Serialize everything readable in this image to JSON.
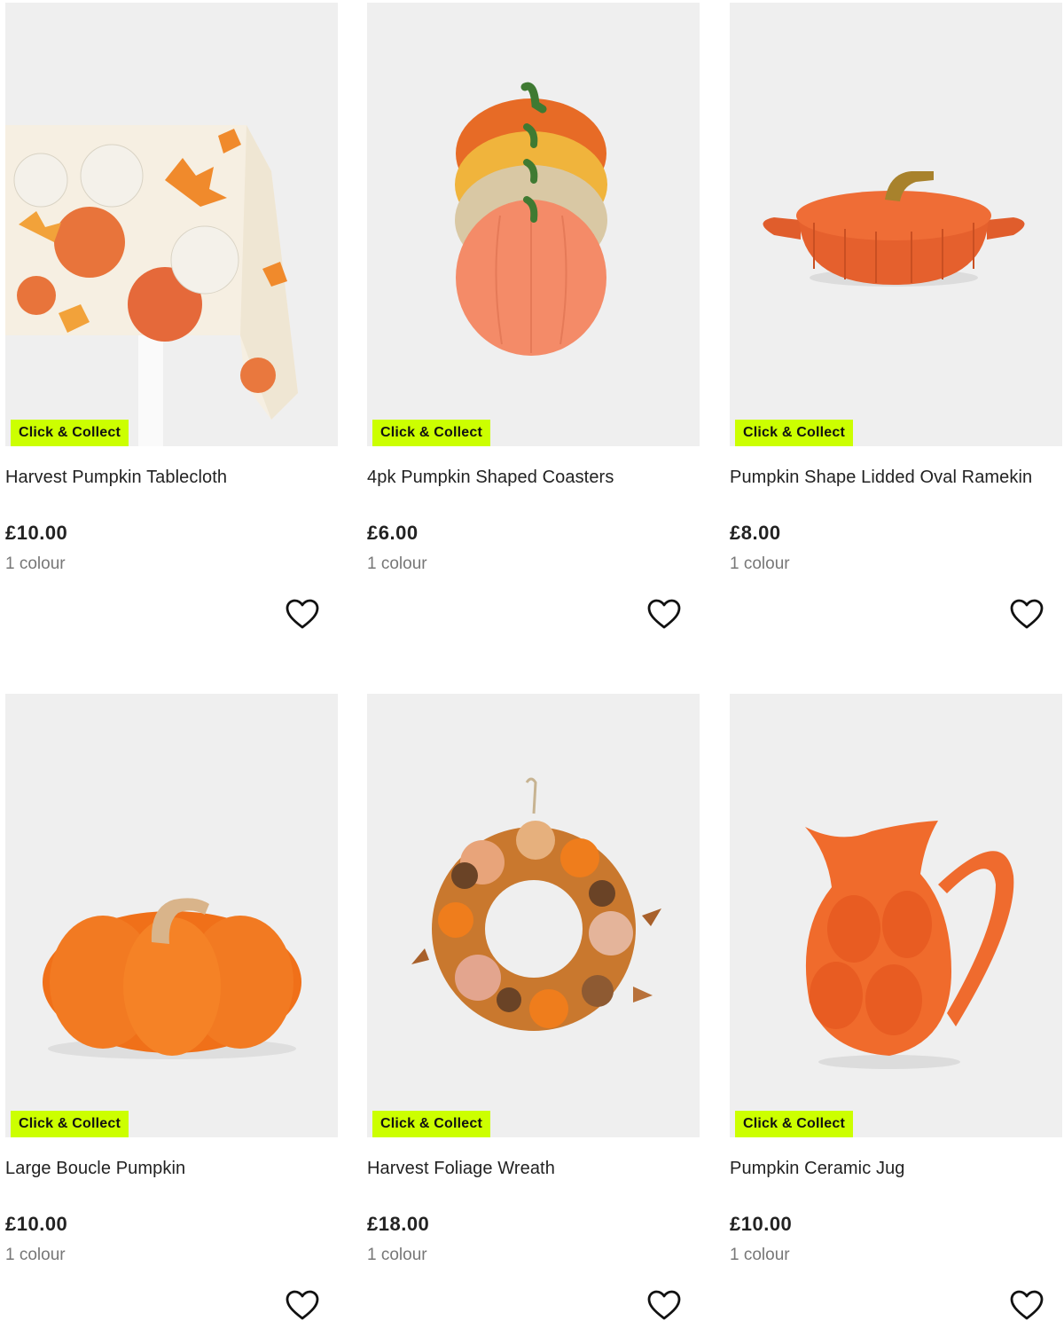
{
  "products": [
    {
      "badge": "Click & Collect",
      "name": "Harvest Pumpkin Tablecloth",
      "price": "£10.00",
      "colours": "1 colour",
      "wishlist_icon": "heart-outline-icon"
    },
    {
      "badge": "Click & Collect",
      "name": "4pk Pumpkin Shaped Coasters",
      "price": "£6.00",
      "colours": "1 colour",
      "wishlist_icon": "heart-outline-icon"
    },
    {
      "badge": "Click & Collect",
      "name": "Pumpkin Shape Lidded Oval Ramekin",
      "price": "£8.00",
      "colours": "1 colour",
      "wishlist_icon": "heart-outline-icon"
    },
    {
      "badge": "Click & Collect",
      "name": "Large Boucle Pumpkin",
      "price": "£10.00",
      "colours": "1 colour",
      "wishlist_icon": "heart-outline-icon"
    },
    {
      "badge": "Click & Collect",
      "name": "Harvest Foliage Wreath",
      "price": "£18.00",
      "colours": "1 colour",
      "wishlist_icon": "heart-outline-icon"
    },
    {
      "badge": "Click & Collect",
      "name": "Pumpkin Ceramic Jug",
      "price": "£10.00",
      "colours": "1 colour",
      "wishlist_icon": "heart-outline-icon"
    }
  ],
  "colors": {
    "badge_background": "#ccff00",
    "image_background": "#efefef",
    "price_text": "#222222",
    "secondary_text": "#777777"
  }
}
